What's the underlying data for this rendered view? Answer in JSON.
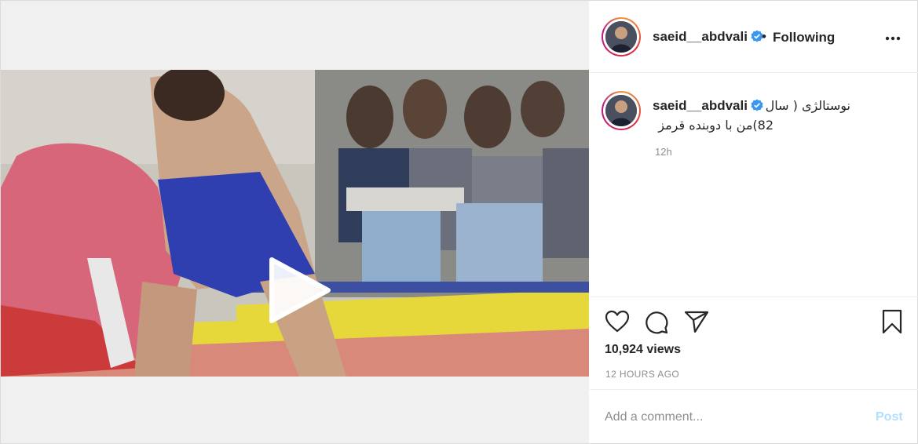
{
  "post": {
    "author": {
      "username": "saeid__abdvali",
      "verified": true,
      "follow_status": "Following",
      "separator": "•"
    },
    "media": {
      "type": "video",
      "play_icon": "play-icon"
    },
    "caption": {
      "username": "saeid__abdvali",
      "text_line1": "نوستالژی ( سال",
      "text_line2": "82)من با دوبنده قرمز",
      "time": "12h"
    },
    "actions": {
      "like_icon": "heart-icon",
      "comment_icon": "comment-icon",
      "share_icon": "paper-plane-icon",
      "save_icon": "bookmark-icon"
    },
    "views": "10,924 views",
    "timestamp": "12 HOURS AGO",
    "comment_box": {
      "placeholder": "Add a comment...",
      "post_label": "Post"
    }
  },
  "colors": {
    "verified_blue": "#3897f0",
    "post_button_disabled": "#b2dffc",
    "secondary_text": "#8e8e8e",
    "border": "#dbdbdb"
  }
}
